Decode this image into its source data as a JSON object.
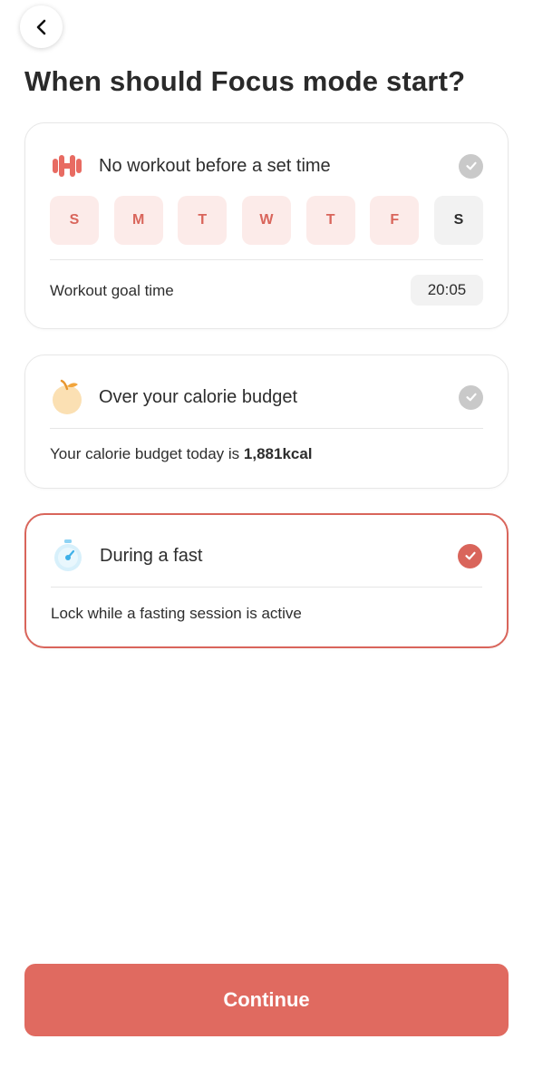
{
  "header": {
    "title": "When should Focus mode start?",
    "back_icon": "chevron-left-icon"
  },
  "cards": {
    "workout": {
      "title": "No workout before a set time",
      "icon": "dumbbell-icon",
      "selected": false,
      "days": [
        {
          "label": "S",
          "active": true
        },
        {
          "label": "M",
          "active": true
        },
        {
          "label": "T",
          "active": true
        },
        {
          "label": "W",
          "active": true
        },
        {
          "label": "T",
          "active": true
        },
        {
          "label": "F",
          "active": true
        },
        {
          "label": "S",
          "active": false
        }
      ],
      "goal_label": "Workout goal time",
      "goal_time": "20:05"
    },
    "calorie": {
      "title": "Over your calorie budget",
      "icon": "peach-icon",
      "selected": false,
      "budget_prefix": "Your calorie budget today is ",
      "budget_value": "1,881kcal"
    },
    "fast": {
      "title": "During a fast",
      "icon": "stopwatch-icon",
      "selected": true,
      "description": "Lock while a fasting session is active"
    }
  },
  "footer": {
    "continue_label": "Continue"
  },
  "colors": {
    "accent": "#e06a60",
    "accent_border": "#d9655b",
    "day_active_bg": "#fcebe9",
    "check_off": "#c9c9c9"
  }
}
